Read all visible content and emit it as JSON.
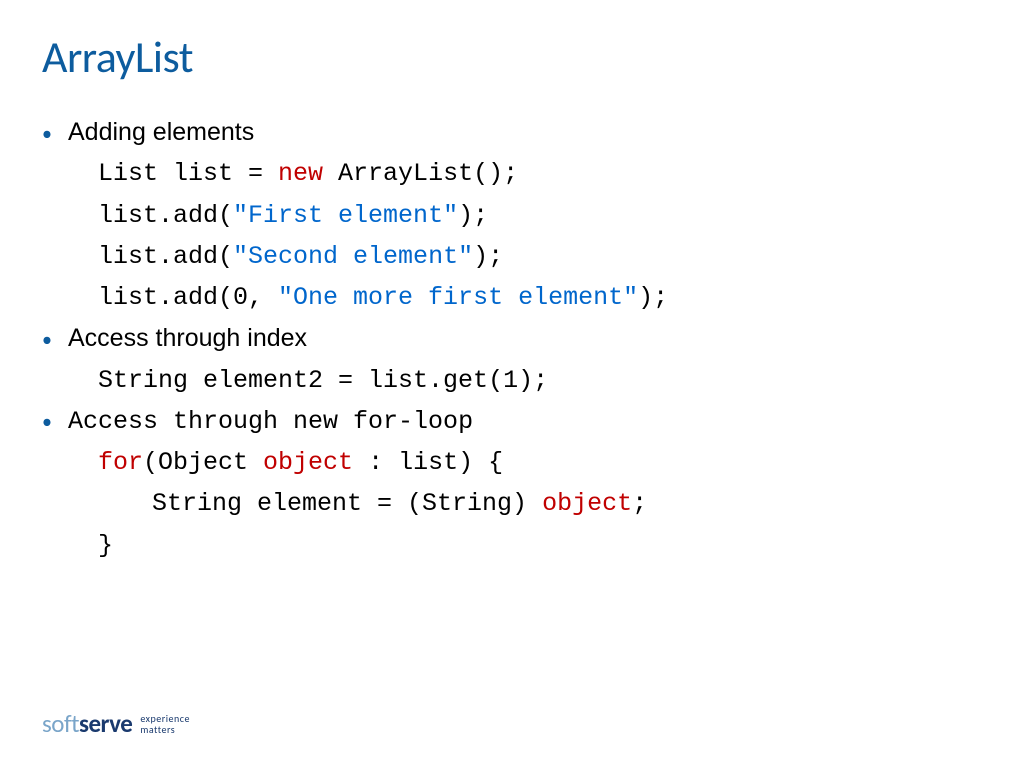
{
  "title": "ArrayList",
  "bullets": {
    "b1": "Adding elements",
    "b2": "Access through index",
    "b3": "Access through new for-loop"
  },
  "code": {
    "line1_a": "List list = ",
    "line1_kw": "new",
    "line1_b": " ArrayList();",
    "line2_a": "list.add(",
    "line2_str": "\"First element\"",
    "line2_b": ");",
    "line3_a": "list.add(",
    "line3_str": "\"Second element\"",
    "line3_b": ");",
    "line4_a": "list.add(0, ",
    "line4_str": "\"One more first element\"",
    "line4_b": ");",
    "line5": "String element2 = list.get(1);",
    "line6_kw": "for",
    "line6_a": "(Object ",
    "line6_obj": "object",
    "line6_b": " : list) {",
    "line7_a": "String element = (String) ",
    "line7_obj": "object",
    "line7_b": ";",
    "line8": "}"
  },
  "logo": {
    "soft": "soft",
    "serve": "serve",
    "tag1": "experience",
    "tag2": "matters"
  }
}
